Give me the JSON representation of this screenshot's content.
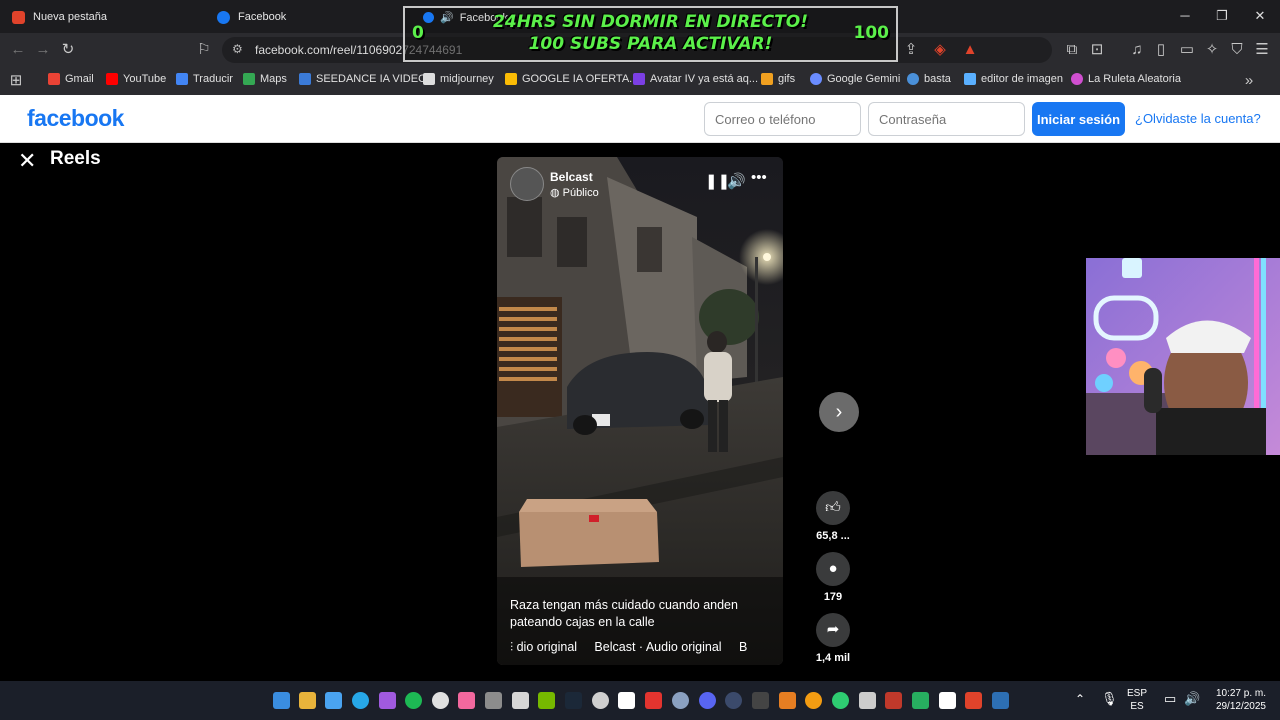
{
  "browser": {
    "tabs": [
      {
        "title": "Nueva pestaña"
      },
      {
        "title": "Facebook"
      }
    ],
    "url": "facebook.com/reel/1106902724744691",
    "bookmarks": [
      "Gmail",
      "YouTube",
      "Traducir",
      "Maps",
      "SEEDANCE IA VIDEO",
      "midjourney",
      "GOOGLE IA OFERTA...",
      "Avatar IV ya está aq...",
      "gifs",
      "Google Gemini",
      "basta",
      "editor de imagen",
      "La Ruleta Aleatoria"
    ]
  },
  "overlay": {
    "tab_title": "Facebook",
    "line1": "24HRS SIN DORMIR EN DIRECTO!",
    "line2": "100 SUBS PARA ACTIVAR!",
    "count_left": "0",
    "count_right": "100"
  },
  "facebook": {
    "logo": "facebook",
    "email_placeholder": "Correo o teléfono",
    "password_placeholder": "Contraseña",
    "login_label": "Iniciar sesión",
    "forgot_label": "¿Olvidaste la cuenta?"
  },
  "reels": {
    "title": "Reels",
    "author": "Belcast",
    "privacy": "Público",
    "caption": "Raza tengan más cuidado cuando anden pateando cajas en la calle",
    "audio": "dio original     Belcast · Audio original     B",
    "likes": "65,8 ...",
    "comments": "179",
    "shares": "1,4 mil"
  },
  "taskbar": {
    "lang_top": "ESP",
    "lang_bottom": "ES",
    "time": "10:27 p. m.",
    "date": "29/12/2025"
  },
  "colors": {
    "facebook_blue": "#1877f2",
    "overlay_green": "#5bf04a",
    "browser_dark": "#2b2b2f"
  }
}
